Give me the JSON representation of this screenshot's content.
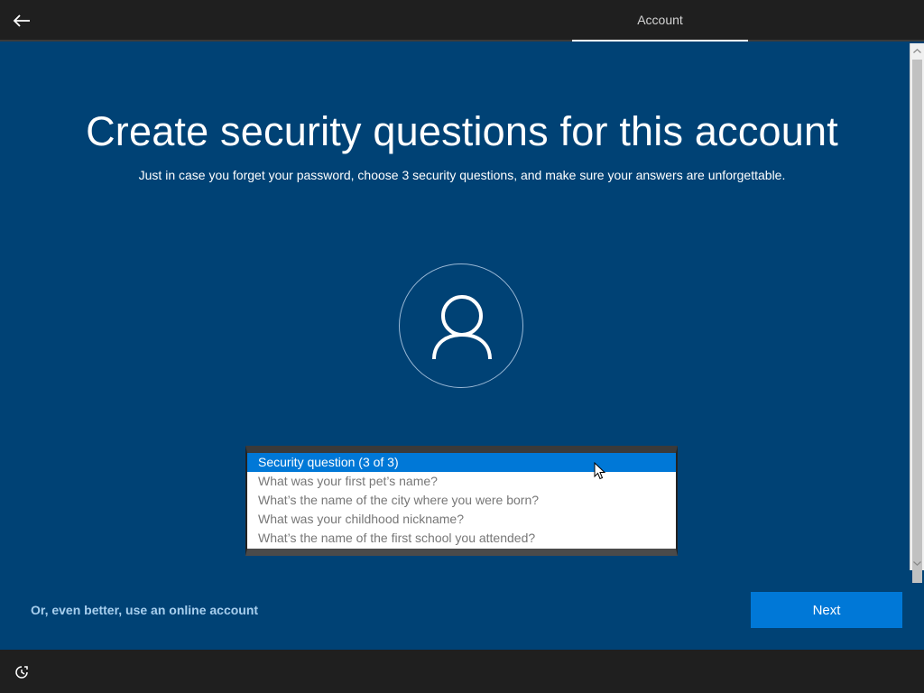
{
  "header": {
    "back_icon": "arrow-left-icon",
    "tab_label": "Account"
  },
  "main": {
    "title": "Create security questions for this account",
    "subtitle": "Just in case you forget your password, choose 3 security questions, and make sure your answers are unforgettable.",
    "avatar_icon": "user-icon"
  },
  "dropdown": {
    "options": [
      "Security question (3 of 3)",
      "What was your first pet’s name?",
      "What’s the name of the city where you were born?",
      "What was your childhood nickname?",
      "What’s the name of the first school you attended?"
    ],
    "selected_index": 0
  },
  "footer": {
    "online_account_link": "Or, even better, use an online account",
    "next_label": "Next",
    "ease_of_access_icon": "ease-of-access-icon"
  },
  "colors": {
    "background": "#004275",
    "accent": "#0078d7",
    "bar": "#1f1f1f"
  }
}
